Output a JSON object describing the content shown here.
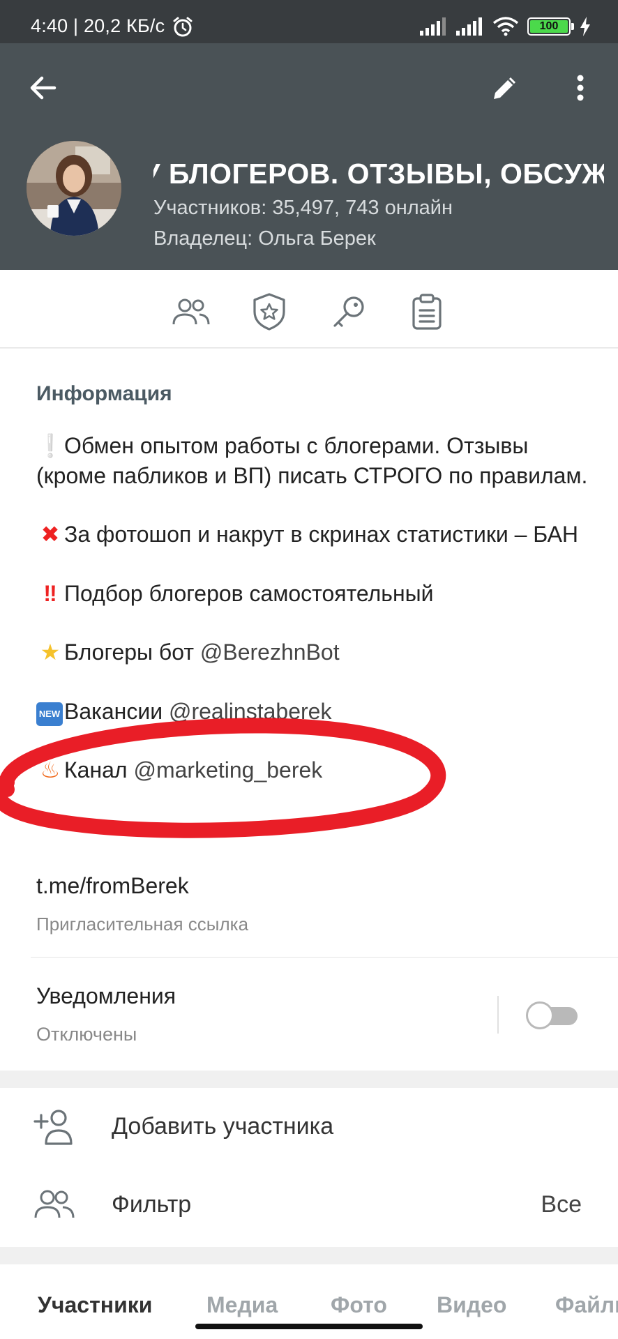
{
  "status_bar": {
    "time": "4:40 | 20,2 КБ/с",
    "battery": "100"
  },
  "header": {
    "title": "У БЛОГЕРОВ. ОТЗЫВЫ, ОБСУЖДЕНИЯ",
    "members": "Участников: 35,497, 743 онлайн",
    "owner": "Владелец:  Ольга Берек"
  },
  "icon_tabs": [
    "members-icon",
    "admins-shield-icon",
    "key-icon",
    "clipboard-icon"
  ],
  "info": {
    "section_title": "Информация",
    "lines": {
      "l1": "Обмен опытом работы с блогерами. Отзывы (кроме пабликов и ВП) писать СТРОГО по правилам.",
      "l2": "За фотошоп и накрут в скринах статистики – БАН",
      "l3": "Подбор блогеров самостоятельный",
      "l4_text": "Блогеры бот ",
      "l4_mention": "@BerezhnBot",
      "l5_text": "Вакансии ",
      "l5_mention": "@realinstaberek",
      "l6_text": "Канал ",
      "l6_mention": "@marketing_berek"
    },
    "invite_link": "t.me/fromBerek",
    "invite_label": "Пригласительная ссылка"
  },
  "notifications": {
    "label": "Уведомления",
    "status": "Отключены",
    "enabled": false
  },
  "actions": {
    "add_member": "Добавить участника",
    "filter": "Фильтр",
    "filter_value": "Все"
  },
  "bottom_tabs": {
    "members": "Участники",
    "media": "Медиа",
    "photo": "Фото",
    "video": "Видео",
    "files": "Файлы"
  },
  "colors": {
    "header_bg": "#4a5256",
    "status_bg": "#383c3f",
    "annotation_red": "#e8121b"
  }
}
